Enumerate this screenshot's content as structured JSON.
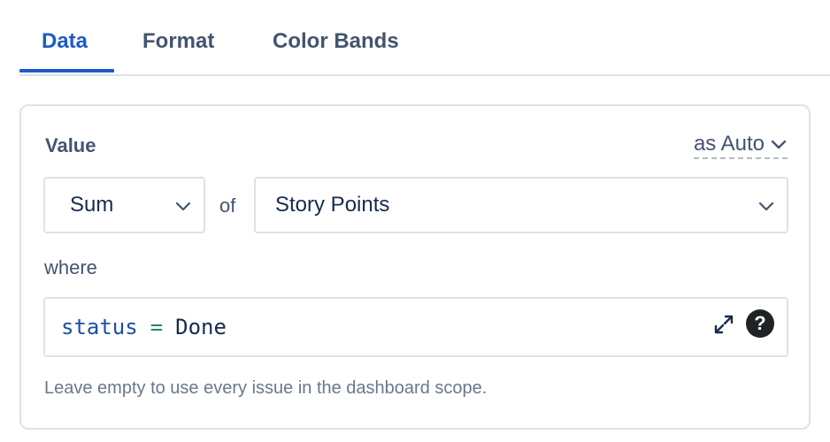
{
  "tabs": [
    {
      "label": "Data",
      "active": true
    },
    {
      "label": "Format",
      "active": false
    },
    {
      "label": "Color Bands",
      "active": false
    }
  ],
  "colors": {
    "accent": "#1d5bc7",
    "text": "#44546f",
    "border": "#dfe1e6",
    "query_field": "#1d4ea8",
    "query_operator": "#1f8a5b"
  },
  "value_section": {
    "label": "Value",
    "display_mode": "as Auto",
    "aggregation": "Sum",
    "of_label": "of",
    "field": "Story Points"
  },
  "filter": {
    "where_label": "where",
    "query": {
      "field": "status",
      "operator": "=",
      "value": "Done"
    },
    "expand_icon": "expand-icon",
    "help_icon": "help-icon",
    "help_symbol": "?",
    "helper_text": "Leave empty to use every issue in the dashboard scope."
  }
}
